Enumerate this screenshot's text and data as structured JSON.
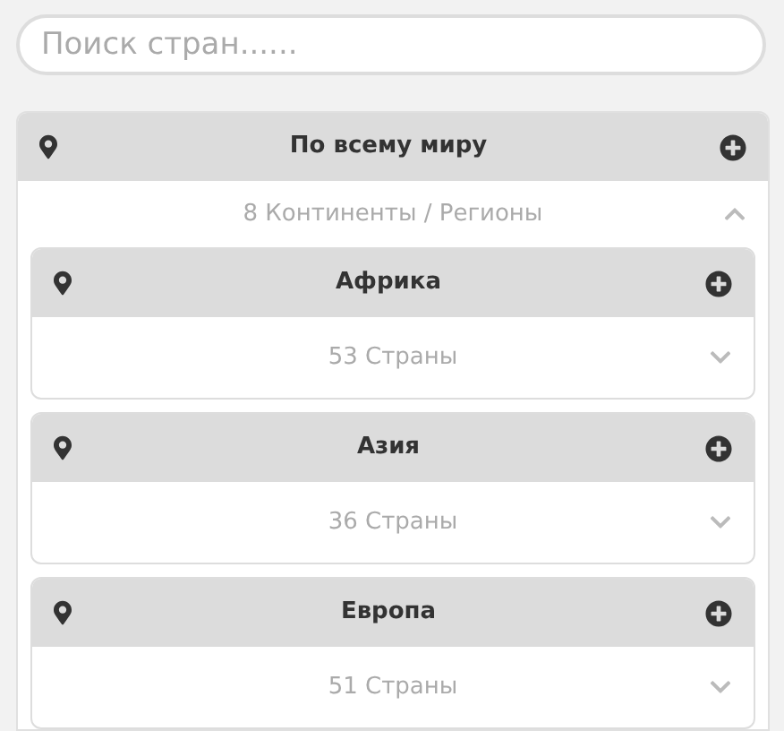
{
  "search": {
    "placeholder": "Поиск стран......"
  },
  "world": {
    "title": "По всему миру",
    "summary": "8 Континенты / Регионы",
    "expanded": true,
    "regions": [
      {
        "title": "Африка",
        "summary": "53 Страны",
        "expanded": false
      },
      {
        "title": "Азия",
        "summary": "36 Страны",
        "expanded": false
      },
      {
        "title": "Европа",
        "summary": "51 Страны",
        "expanded": false
      }
    ]
  }
}
